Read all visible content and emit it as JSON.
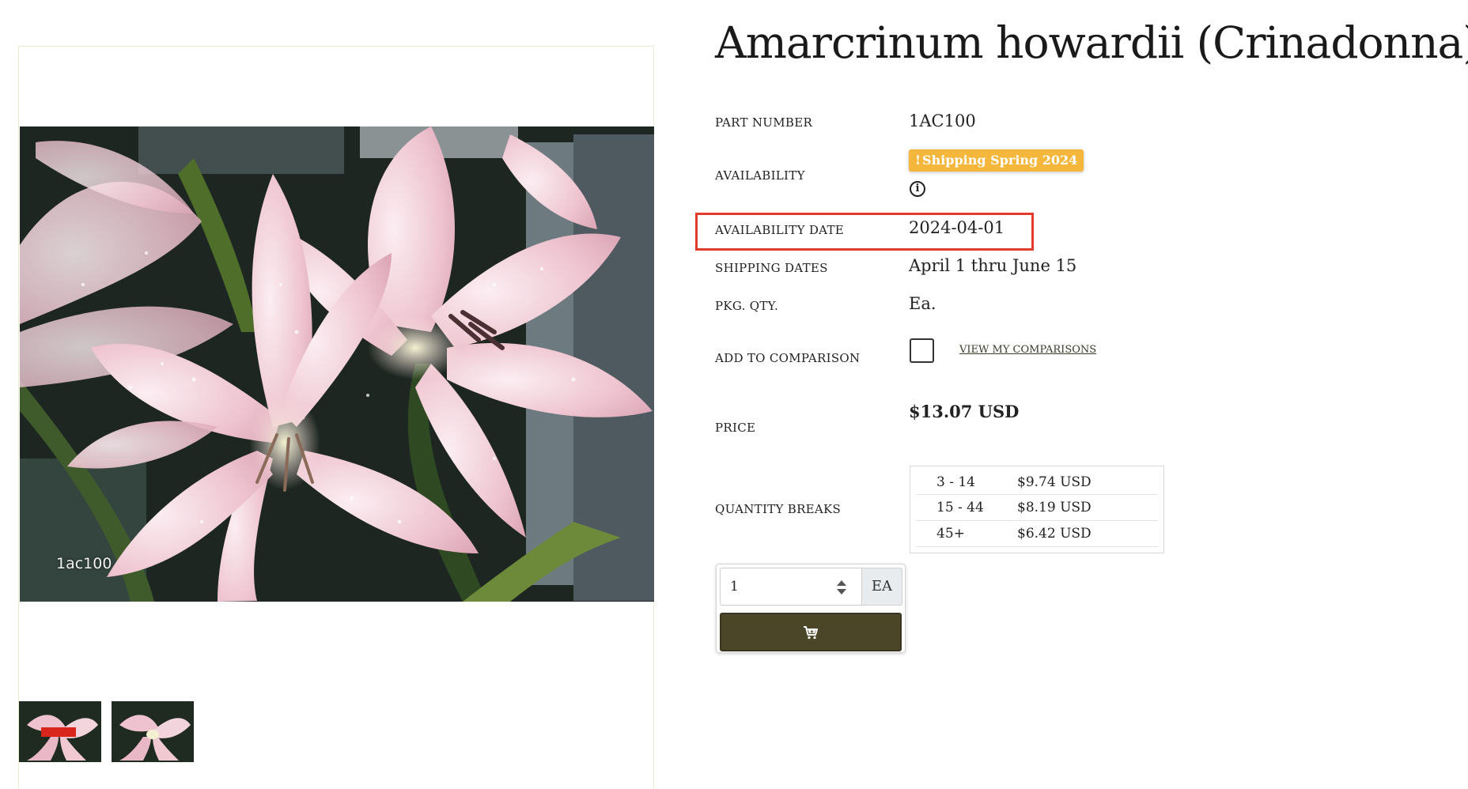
{
  "product": {
    "title": "Amarcrinum howardii (Crinadonna)"
  },
  "gallery": {
    "main_image_alt": "Pink Amarcrinum flowers with water droplets",
    "image_caption": "1ac100",
    "thumbnails": [
      {
        "alt": "Amarcrinum thumbnail with label"
      },
      {
        "alt": "Amarcrinum thumbnail"
      }
    ]
  },
  "details": {
    "part_number_label": "PART NUMBER",
    "part_number": "1AC100",
    "availability_label": "AVAILABILITY",
    "availability_badge_icon": "!",
    "availability_badge": "Shipping Spring 2024",
    "availability_date_label": "AVAILABILITY DATE",
    "availability_date": "2024-04-01",
    "shipping_dates_label": "SHIPPING DATES",
    "shipping_dates": "April 1 thru June 15",
    "pkg_qty_label": "PKG. QTY.",
    "pkg_qty": "Ea.",
    "comparison_label": "ADD TO COMPARISON",
    "comparison_link": "VIEW MY COMPARISONS",
    "price_label": "PRICE",
    "price": "$13.07 USD",
    "quantity_breaks_label": "QUANTITY BREAKS",
    "quantity_breaks": [
      {
        "qty": "3 - 14",
        "price": "$9.74 USD"
      },
      {
        "qty": "15 - 44",
        "price": "$8.19 USD"
      },
      {
        "qty": "45+",
        "price": "$6.42 USD"
      }
    ]
  },
  "cart": {
    "quantity": "1",
    "unit": "EA",
    "add_icon": "cart-plus-icon"
  },
  "colors": {
    "badge": "#f4b73c",
    "highlight": "#e33b2b",
    "cart_button": "#4c4628"
  }
}
